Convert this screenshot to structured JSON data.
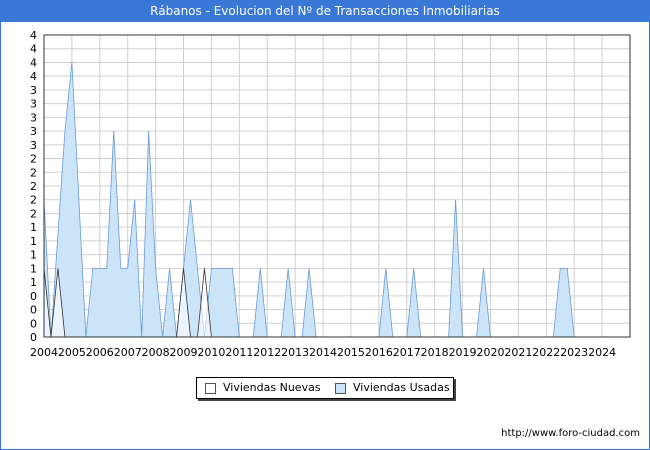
{
  "header": {
    "title": "Rábanos - Evolucion del Nº de Transacciones Inmobiliarias"
  },
  "source": "http://www.foro-ciudad.com",
  "chart_data": {
    "type": "area",
    "title": "Rábanos - Evolucion del Nº de Transacciones Inmobiliarias",
    "xlabel": "",
    "ylabel": "",
    "x_ticks": [
      "2004",
      "2005",
      "2006",
      "2007",
      "2008",
      "2009",
      "2010",
      "2011",
      "2012",
      "2013",
      "2014",
      "2015",
      "2016",
      "2017",
      "2018",
      "2019",
      "2020",
      "2021",
      "2022",
      "2023",
      "2024"
    ],
    "y_ticks": [
      "0",
      "0",
      "0",
      "0",
      "1",
      "1",
      "1",
      "1",
      "1",
      "2",
      "2",
      "2",
      "2",
      "2",
      "3",
      "3",
      "3",
      "3",
      "3",
      "4",
      "4",
      "4",
      "4"
    ],
    "xlim": [
      2004,
      2025
    ],
    "ylim": [
      0,
      4.4
    ],
    "grid": true,
    "legend_position": "bottom",
    "series": [
      {
        "name": "Viviendas Usadas",
        "color": "#cce4f7",
        "stroke": "#6a9ad4",
        "x": [
          2004.0,
          2004.25,
          2004.75,
          2005.0,
          2005.5,
          2005.75,
          2006.25,
          2006.5,
          2006.75,
          2007.0,
          2007.25,
          2007.5,
          2007.75,
          2008.0,
          2008.25,
          2008.5,
          2008.75,
          2009.0,
          2009.25,
          2009.75,
          2010.0,
          2010.25,
          2010.5,
          2010.75,
          2011.0,
          2011.25,
          2011.5,
          2011.75,
          2012.0,
          2012.25,
          2012.5,
          2012.75,
          2013.0,
          2013.25,
          2013.5,
          2013.75,
          2014.0,
          2014.25,
          2014.5,
          2014.75,
          2015.0,
          2015.25,
          2015.5,
          2015.75,
          2016.0,
          2016.25,
          2016.5,
          2016.75,
          2017.0,
          2017.25,
          2017.5,
          2017.75,
          2018.0,
          2018.25,
          2018.5,
          2018.75,
          2019.0,
          2019.25,
          2019.5,
          2019.75,
          2020.0,
          2020.25,
          2020.5,
          2020.75,
          2021.0,
          2021.25,
          2021.5,
          2021.75,
          2022.0,
          2022.25,
          2022.5,
          2022.75,
          2023.0,
          2023.25,
          2023.5,
          2023.75,
          2024.0
        ],
        "values": [
          2.0,
          0.0,
          3.0,
          4.0,
          0.0,
          1.0,
          1.0,
          3.0,
          1.0,
          1.0,
          2.0,
          0.0,
          3.0,
          1.0,
          0.0,
          1.0,
          0.0,
          1.0,
          2.0,
          0.0,
          1.0,
          1.0,
          1.0,
          1.0,
          0.0,
          0.0,
          0.0,
          1.0,
          0.0,
          0.0,
          0.0,
          1.0,
          0.0,
          0.0,
          1.0,
          0.0,
          0.0,
          0.0,
          0.0,
          0.0,
          0.0,
          0.0,
          0.0,
          0.0,
          0.0,
          1.0,
          0.0,
          0.0,
          0.0,
          1.0,
          0.0,
          0.0,
          0.0,
          0.0,
          0.0,
          2.0,
          0.0,
          0.0,
          0.0,
          1.0,
          0.0,
          0.0,
          0.0,
          0.0,
          0.0,
          0.0,
          0.0,
          0.0,
          0.0,
          0.0,
          1.0,
          1.0,
          0.0,
          0.0,
          0.0,
          0.0,
          0.0
        ]
      },
      {
        "name": "Viviendas Nuevas",
        "color": "#ffffff",
        "stroke": "#333333",
        "x": [
          2004.0,
          2004.25,
          2004.5,
          2004.75,
          2005.0,
          2008.5,
          2008.75,
          2009.0,
          2009.25,
          2009.5,
          2009.75,
          2010.0,
          2010.25
        ],
        "values": [
          1.0,
          0.0,
          1.0,
          0.0,
          0.0,
          0.0,
          0.0,
          1.0,
          0.0,
          0.0,
          1.0,
          0.0,
          0.0
        ]
      }
    ]
  }
}
